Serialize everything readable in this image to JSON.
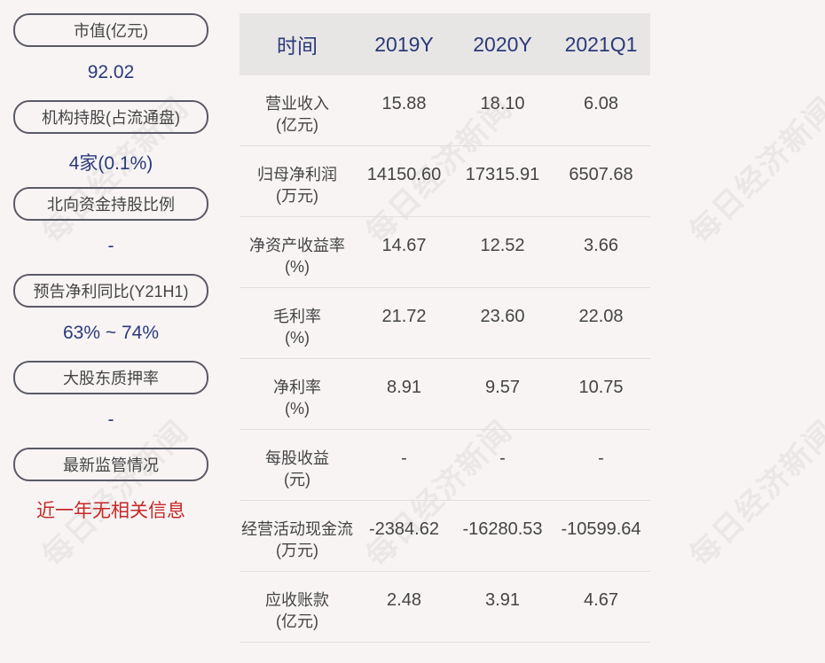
{
  "watermark_text": "每日经济新闻",
  "left_panel": [
    {
      "label": "市值(亿元)",
      "value": "92.02",
      "value_color": "#2a3a7a"
    },
    {
      "label": "机构持股(占流通盘)",
      "value": "4家(0.1%)",
      "value_color": "#2a3a7a"
    },
    {
      "label": "北向资金持股比例",
      "value": "-",
      "value_color": "#2a3a7a"
    },
    {
      "label": "预告净利同比(Y21H1)",
      "value": "63% ~ 74%",
      "value_color": "#2a3a7a"
    },
    {
      "label": "大股东质押率",
      "value": "-",
      "value_color": "#2a3a7a"
    },
    {
      "label": "最新监管情况",
      "value": "近一年无相关信息",
      "value_color": "#c62828"
    }
  ],
  "table": {
    "headers": [
      "时间",
      "2019Y",
      "2020Y",
      "2021Q1"
    ],
    "rows": [
      {
        "label": "营业收入",
        "unit": "(亿元)",
        "values": [
          "15.88",
          "18.10",
          "6.08"
        ]
      },
      {
        "label": "归母净利润",
        "unit": "(万元)",
        "values": [
          "14150.60",
          "17315.91",
          "6507.68"
        ]
      },
      {
        "label": "净资产收益率",
        "unit": "(%)",
        "values": [
          "14.67",
          "12.52",
          "3.66"
        ]
      },
      {
        "label": "毛利率",
        "unit": "(%)",
        "values": [
          "21.72",
          "23.60",
          "22.08"
        ]
      },
      {
        "label": "净利率",
        "unit": "(%)",
        "values": [
          "8.91",
          "9.57",
          "10.75"
        ]
      },
      {
        "label": "每股收益",
        "unit": "(元)",
        "values": [
          "-",
          "-",
          "-"
        ]
      },
      {
        "label": "经营活动现金流",
        "unit": "(万元)",
        "values": [
          "-2384.62",
          "-16280.53",
          "-10599.64"
        ]
      },
      {
        "label": "应收账款",
        "unit": "(亿元)",
        "values": [
          "2.48",
          "3.91",
          "4.67"
        ]
      }
    ]
  }
}
